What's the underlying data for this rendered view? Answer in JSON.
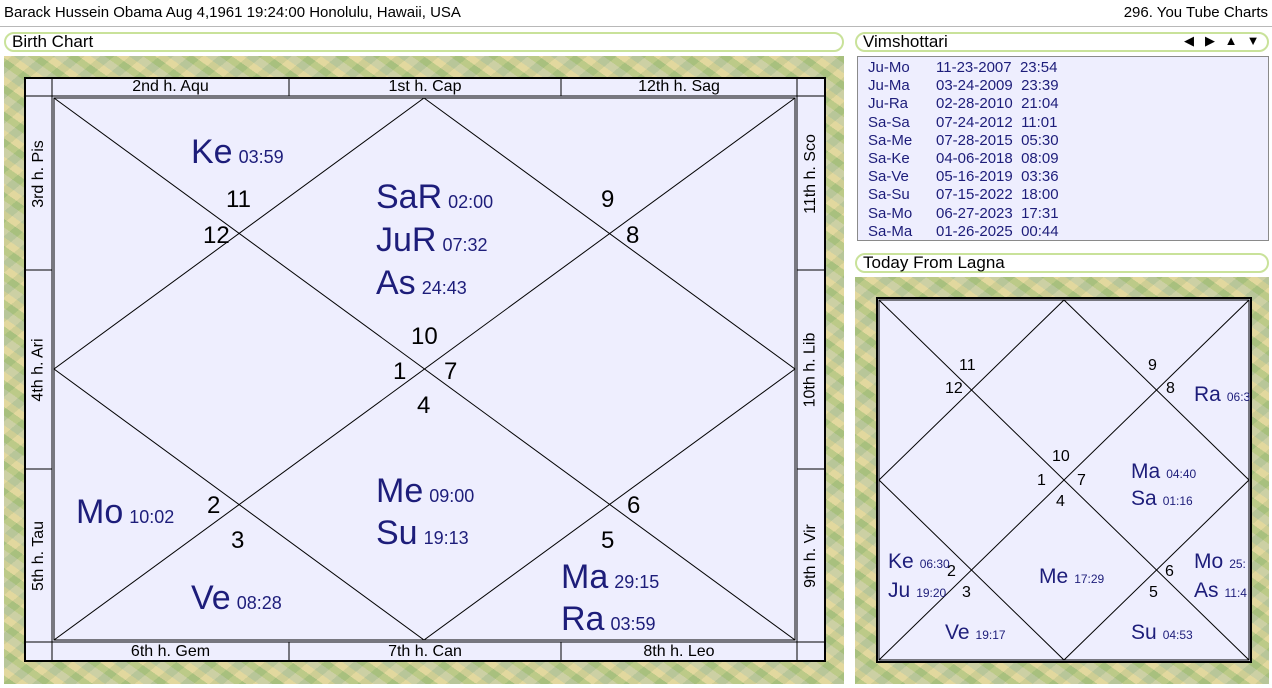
{
  "header": {
    "left_text": "Barack Hussein Obama Aug 4,1961 19:24:00  Honolulu, Hawaii, USA",
    "right_text": "296. You Tube Charts"
  },
  "panels": {
    "birth_chart_title": "Birth Chart",
    "vimshottari_title": "Vimshottari",
    "today_title": "Today From Lagna"
  },
  "icons": [
    "triangle-left-icon",
    "triangle-right-icon",
    "triangle-up-icon",
    "triangle-down-icon"
  ],
  "icon_glyphs": {
    "left": "◀",
    "right": "▶",
    "up": "▲",
    "down": "▼"
  },
  "house_labels": {
    "top": [
      "2nd h.  Aqu",
      "1st h.  Cap",
      "12th h.  Sag"
    ],
    "bottom": [
      "6th h.  Gem",
      "7th h.  Can",
      "8th h.  Leo"
    ],
    "left": [
      "3rd h.  Pis",
      "4th h.  Ari",
      "5th h.  Tau"
    ],
    "right": [
      "11th h.  Sco",
      "10th h.  Lib",
      "9th h.  Vir"
    ]
  },
  "birth_chart": {
    "sign_numbers": [
      "11",
      "12",
      "9",
      "8",
      "10",
      "1",
      "7",
      "4",
      "2",
      "3",
      "6",
      "5"
    ],
    "planets": [
      {
        "name": "Ke",
        "deg": "03:59"
      },
      {
        "name": "SaR",
        "deg": "02:00"
      },
      {
        "name": "JuR",
        "deg": "07:32"
      },
      {
        "name": "As",
        "deg": "24:43"
      },
      {
        "name": "Mo",
        "deg": "10:02"
      },
      {
        "name": "Me",
        "deg": "09:00"
      },
      {
        "name": "Su",
        "deg": "19:13"
      },
      {
        "name": "Ve",
        "deg": "08:28"
      },
      {
        "name": "Ma",
        "deg": "29:15"
      },
      {
        "name": "Ra",
        "deg": "03:59"
      }
    ]
  },
  "vimshottari": [
    {
      "lords": "Ju-Mo",
      "date": "11-23-2007  23:54"
    },
    {
      "lords": "Ju-Ma",
      "date": "03-24-2009  23:39"
    },
    {
      "lords": "Ju-Ra",
      "date": "02-28-2010  21:04"
    },
    {
      "lords": "Sa-Sa",
      "date": "07-24-2012  11:01"
    },
    {
      "lords": "Sa-Me",
      "date": "07-28-2015  05:30"
    },
    {
      "lords": "Sa-Ke",
      "date": "04-06-2018  08:09"
    },
    {
      "lords": "Sa-Ve",
      "date": "05-16-2019  03:36"
    },
    {
      "lords": "Sa-Su",
      "date": "07-15-2022  18:00"
    },
    {
      "lords": "Sa-Mo",
      "date": "06-27-2023  17:31"
    },
    {
      "lords": "Sa-Ma",
      "date": "01-26-2025  00:44"
    }
  ],
  "today_chart": {
    "sign_numbers": [
      "11",
      "12",
      "9",
      "8",
      "10",
      "1",
      "7",
      "4",
      "2",
      "3",
      "6",
      "5"
    ],
    "planets": [
      {
        "name": "Ra",
        "deg": "06:3"
      },
      {
        "name": "Ma",
        "deg": "04:40"
      },
      {
        "name": "Sa",
        "deg": "01:16"
      },
      {
        "name": "Ke",
        "deg": "06:30"
      },
      {
        "name": "Ju",
        "deg": "19:20"
      },
      {
        "name": "Me",
        "deg": "17:29"
      },
      {
        "name": "Mo",
        "deg": "25:"
      },
      {
        "name": "As",
        "deg": "11:4"
      },
      {
        "name": "Ve",
        "deg": "19:17"
      },
      {
        "name": "Su",
        "deg": "04:53"
      }
    ]
  },
  "colors": {
    "planet_text": "#1d1d7a",
    "panel_border": "#c9e29a",
    "chart_bg": "#eeeefe"
  }
}
